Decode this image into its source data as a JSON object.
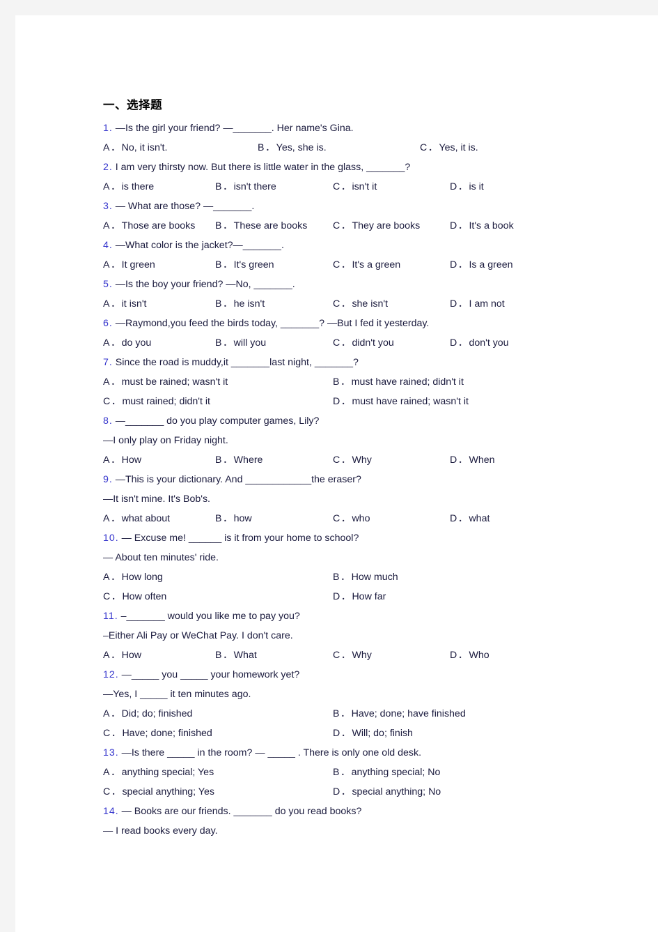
{
  "heading": "一、选择题",
  "colors": {
    "page_background": "#ffffff",
    "outer_background": "#f4f4f4",
    "question_number": "#3333cc",
    "body_text": "#1a1a3d"
  },
  "questions": [
    {
      "num": "1.",
      "stem": "—Is the girl your friend?   —_______. Her name's Gina.",
      "continuation": null,
      "layout": "cols3",
      "options": [
        {
          "letter": "A．",
          "text": "No, it isn't."
        },
        {
          "letter": "B．",
          "text": "Yes, she is."
        },
        {
          "letter": "C．",
          "text": "Yes, it is."
        }
      ]
    },
    {
      "num": "2.",
      "stem": "I am very thirsty now. But there is little water in the glass, _______?",
      "continuation": null,
      "layout": "cols4",
      "options": [
        {
          "letter": "A．",
          "text": "is there"
        },
        {
          "letter": "B．",
          "text": "isn't there"
        },
        {
          "letter": "C．",
          "text": "isn't it"
        },
        {
          "letter": "D．",
          "text": "is it"
        }
      ]
    },
    {
      "num": "3.",
      "stem": "— What are those?  —_______.",
      "continuation": null,
      "layout": "cols4",
      "options": [
        {
          "letter": "A．",
          "text": "Those are books"
        },
        {
          "letter": "B．",
          "text": "These are books"
        },
        {
          "letter": "C．",
          "text": "They are books"
        },
        {
          "letter": "D．",
          "text": "It's a book"
        }
      ]
    },
    {
      "num": "4.",
      "stem": "—What color is the jacket?—_______.",
      "continuation": null,
      "layout": "cols4",
      "options": [
        {
          "letter": "A．",
          "text": "It green"
        },
        {
          "letter": "B．",
          "text": "It's green"
        },
        {
          "letter": "C．",
          "text": "It's a green"
        },
        {
          "letter": "D．",
          "text": "Is a green"
        }
      ]
    },
    {
      "num": "5.",
      "stem": "—Is the boy your friend? —No, _______.",
      "continuation": null,
      "layout": "cols4",
      "options": [
        {
          "letter": "A．",
          "text": "it isn't"
        },
        {
          "letter": "B．",
          "text": "he isn't"
        },
        {
          "letter": "C．",
          "text": "she isn't"
        },
        {
          "letter": "D．",
          "text": "I am not"
        }
      ]
    },
    {
      "num": "6.",
      "stem": "—Raymond,you feed the birds today, _______? —But I fed it yesterday.",
      "continuation": null,
      "layout": "cols4",
      "options": [
        {
          "letter": "A．",
          "text": "do you"
        },
        {
          "letter": "B．",
          "text": "will you"
        },
        {
          "letter": "C．",
          "text": "didn't you"
        },
        {
          "letter": "D．",
          "text": "don't you"
        }
      ]
    },
    {
      "num": "7.",
      "stem": "Since the road is muddy,it _______last night, _______?",
      "continuation": null,
      "layout": "cols2",
      "options": [
        {
          "letter": "A．",
          "text": "must be rained; wasn't it"
        },
        {
          "letter": "B．",
          "text": "must have rained; didn't it"
        },
        {
          "letter": "C．",
          "text": "must rained; didn't it"
        },
        {
          "letter": "D．",
          "text": "must have rained; wasn't it"
        }
      ]
    },
    {
      "num": "8.",
      "stem": "—_______ do you play computer games, Lily?",
      "continuation": "—I only play on Friday night.",
      "layout": "cols4",
      "options": [
        {
          "letter": "A．",
          "text": "How"
        },
        {
          "letter": "B．",
          "text": "Where"
        },
        {
          "letter": "C．",
          "text": "Why"
        },
        {
          "letter": "D．",
          "text": "When"
        }
      ]
    },
    {
      "num": "9.",
      "stem": "—This is your dictionary. And ____________the eraser?",
      "continuation": "—It isn't mine. It's Bob's.",
      "layout": "cols4",
      "options": [
        {
          "letter": "A．",
          "text": "what about"
        },
        {
          "letter": "B．",
          "text": "how"
        },
        {
          "letter": "C．",
          "text": "who"
        },
        {
          "letter": "D．",
          "text": "what"
        }
      ]
    },
    {
      "num": "10.",
      "stem": "— Excuse me! ______ is it from your home to school?",
      "continuation": "— About ten minutes' ride.",
      "layout": "cols2",
      "options": [
        {
          "letter": "A．",
          "text": "How long"
        },
        {
          "letter": "B．",
          "text": "How much"
        },
        {
          "letter": "C．",
          "text": "How often"
        },
        {
          "letter": "D．",
          "text": "How far"
        }
      ]
    },
    {
      "num": "11.",
      "stem": "–_______ would you like me to pay you?",
      "continuation": "–Either Ali Pay or WeChat Pay. I don't care.",
      "layout": "cols4",
      "options": [
        {
          "letter": "A．",
          "text": "How"
        },
        {
          "letter": "B．",
          "text": "What"
        },
        {
          "letter": "C．",
          "text": "Why"
        },
        {
          "letter": "D．",
          "text": "Who"
        }
      ]
    },
    {
      "num": "12.",
      "stem": "—_____ you _____ your homework yet?",
      "continuation": "—Yes, I _____ it ten minutes ago.",
      "layout": "cols2",
      "options": [
        {
          "letter": "A．",
          "text": "Did; do; finished"
        },
        {
          "letter": "B．",
          "text": "Have; done; have finished"
        },
        {
          "letter": "C．",
          "text": "Have; done; finished"
        },
        {
          "letter": "D．",
          "text": "Will; do; finish"
        }
      ]
    },
    {
      "num": "13.",
      "stem": "—Is there  _____   in the room? — _____    . There is only one old desk.",
      "continuation": null,
      "layout": "cols2",
      "options": [
        {
          "letter": "A．",
          "text": "anything special; Yes"
        },
        {
          "letter": "B．",
          "text": "anything special; No"
        },
        {
          "letter": "C．",
          "text": "special anything; Yes"
        },
        {
          "letter": "D．",
          "text": "special anything; No"
        }
      ]
    },
    {
      "num": "14.",
      "stem": "— Books are our friends. _______ do you read books?",
      "continuation": "— I read books every day.",
      "layout": null,
      "options": []
    }
  ]
}
